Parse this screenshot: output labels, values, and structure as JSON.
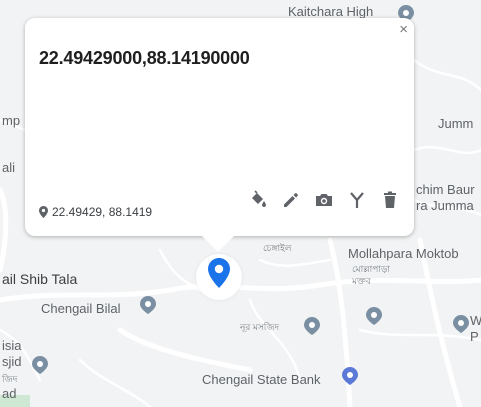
{
  "popup": {
    "title": "22.49429000,88.14190000",
    "coordinates": "22.49429, 88.1419",
    "close_label": "×",
    "tools": [
      "fill-color-icon",
      "edit-icon",
      "camera-icon",
      "route-icon",
      "delete-icon"
    ]
  },
  "map": {
    "labels": {
      "kaitchara": "Kaitchara High",
      "mp": "mp",
      "ali": "ali",
      "jumm": "Jumm",
      "chim_baur": "chim Baur",
      "ra_jumma": "ra Jumma",
      "mollahpara": "Mollahpara Moktob",
      "mollahpara_bn1": "মোল্লাপাড়া",
      "mollahpara_bn2": "মক্তব",
      "bn_top": "চেঙ্গাইল",
      "shib_tala": "ail Shib Tala",
      "chengail_bilal": "Chengail Bilal",
      "masjid_bn": "নূর মসজিদ",
      "w": "W",
      "p": "P",
      "isia": "isia",
      "sjid": "sjid",
      "bn_bottom_left": "জিদ",
      "bottom_left": "ad",
      "chengail_bank": "Chengail State Bank"
    },
    "colors": {
      "background": "#f1f3f4",
      "roads": "#ffffff",
      "marker": "#1a73e8",
      "poi": "#7b8fa3",
      "bank": "#5b79d6"
    }
  }
}
